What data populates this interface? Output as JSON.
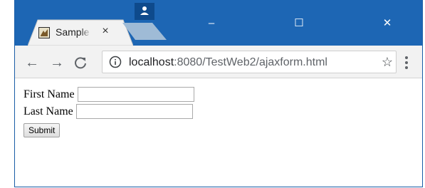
{
  "browser": {
    "tab": {
      "title": "Sample",
      "close_glyph": "×",
      "favicon": "page-favicon-icon"
    },
    "window_controls": {
      "minimize": "–",
      "maximize": "☐",
      "close": "✕"
    },
    "nav": {
      "back": "←",
      "forward": "→",
      "reload": "C"
    },
    "address": {
      "host": "localhost",
      "rest": ":8080/TestWeb2/ajaxform.html"
    },
    "bookmark_glyph": "☆",
    "colors": {
      "titlebar": "#1d66b4",
      "toolbar": "#f2f2f2"
    }
  },
  "form": {
    "first_name_label": "First Name",
    "first_name_value": "",
    "last_name_label": "Last Name",
    "last_name_value": "",
    "submit_label": "Submit"
  }
}
